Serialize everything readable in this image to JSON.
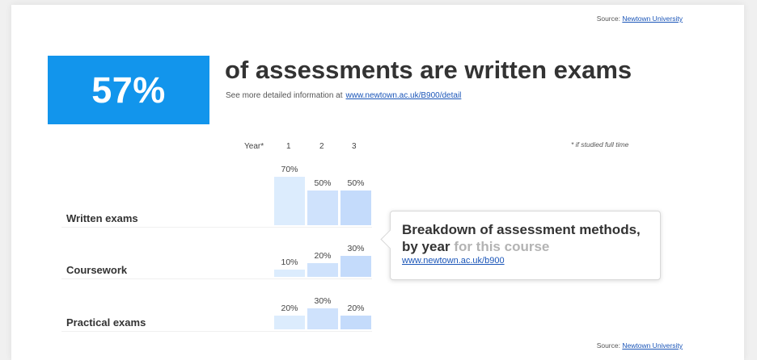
{
  "source": {
    "label": "Source:",
    "link_text": "Newtown University"
  },
  "stat": {
    "value": "57%",
    "headline": "of assessments are written exams",
    "subline_prefix": "See more detailed information at",
    "subline_link": "www.newtown.ac.uk/B900/detail"
  },
  "table": {
    "year_label": "Year*",
    "years": [
      "1",
      "2",
      "3"
    ],
    "footnote": "* if studied full time"
  },
  "chart_data": {
    "type": "bar",
    "categories": [
      "1",
      "2",
      "3"
    ],
    "series": [
      {
        "name": "Written exams",
        "values": [
          70,
          50,
          50
        ],
        "labels": [
          "70%",
          "50%",
          "50%"
        ]
      },
      {
        "name": "Coursework",
        "values": [
          10,
          20,
          30
        ],
        "labels": [
          "10%",
          "20%",
          "30%"
        ]
      },
      {
        "name": "Practical exams",
        "values": [
          20,
          30,
          20
        ],
        "labels": [
          "20%",
          "30%",
          "20%"
        ]
      }
    ],
    "xlabel": "Year*",
    "ylabel": "",
    "ylim": [
      0,
      100
    ],
    "colors": [
      "#dcecfd",
      "#cfe2fc",
      "#c4dbfb"
    ]
  },
  "callout": {
    "title_main": "Breakdown of assessment methods, by year",
    "title_muted": "for this course",
    "link": "www.newtown.ac.uk/b900"
  },
  "colors": {
    "accent": "#1295ec",
    "link": "#1a55b8"
  }
}
